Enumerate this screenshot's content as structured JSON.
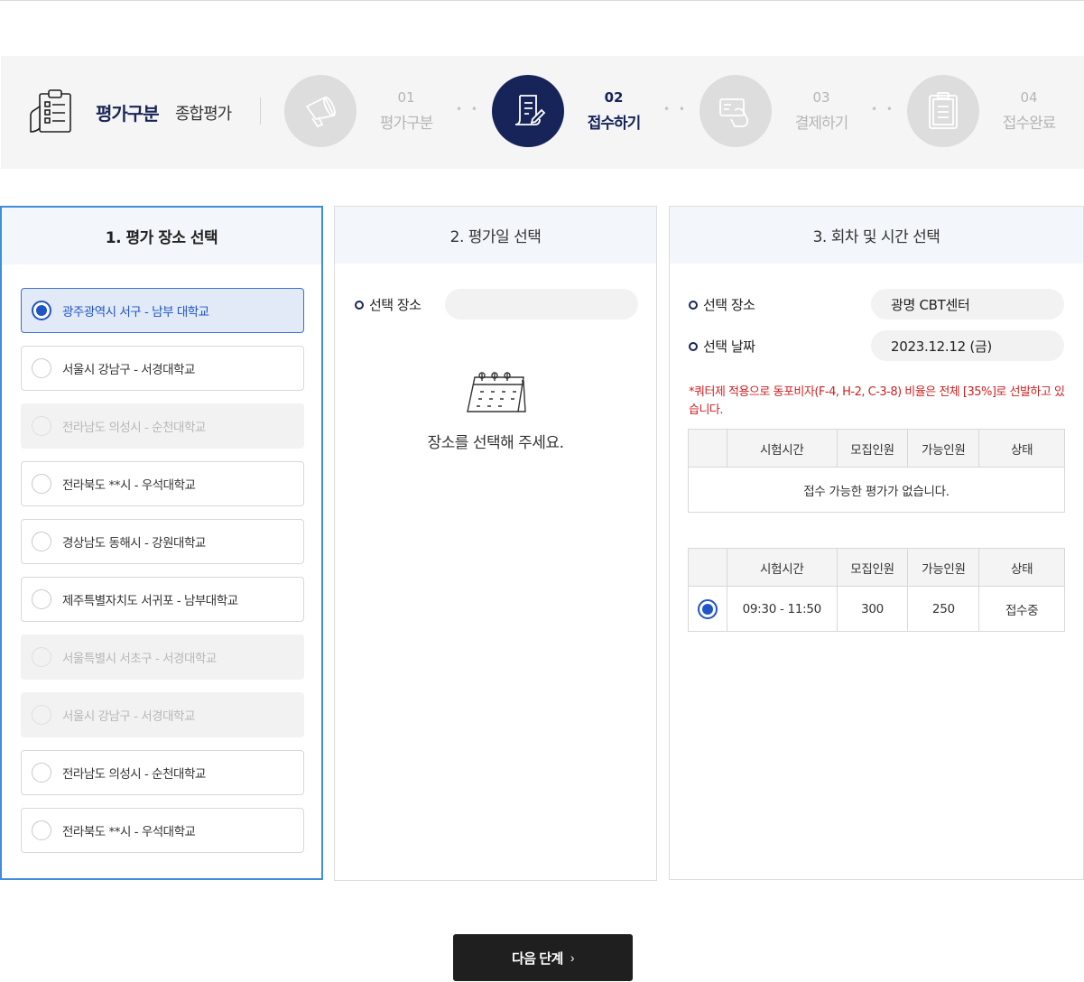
{
  "header": {
    "eval_label": "평가구분",
    "eval_value": "종합평가"
  },
  "steps": [
    {
      "num": "01",
      "name": "평가구분",
      "active": false,
      "icon": "megaphone-icon"
    },
    {
      "num": "02",
      "name": "접수하기",
      "active": true,
      "icon": "document-pen-icon"
    },
    {
      "num": "03",
      "name": "결제하기",
      "active": false,
      "icon": "card-payment-icon"
    },
    {
      "num": "04",
      "name": "접수완료",
      "active": false,
      "icon": "clipboard-icon"
    }
  ],
  "panel1": {
    "title": "1. 평가 장소 선택",
    "locations": [
      {
        "label": "광주광역시 서구 - 남부 대학교",
        "state": "selected"
      },
      {
        "label": "서울시 강남구 - 서경대학교",
        "state": "normal"
      },
      {
        "label": "전라남도 의성시 - 순천대학교",
        "state": "disabled"
      },
      {
        "label": "전라북도 **시 - 우석대학교",
        "state": "normal"
      },
      {
        "label": "경상남도 동해시 - 강원대학교",
        "state": "normal"
      },
      {
        "label": "제주특별자치도 서귀포 - 남부대학교",
        "state": "normal"
      },
      {
        "label": "서울특별시 서초구 - 서경대학교",
        "state": "disabled"
      },
      {
        "label": "서울시 강남구 - 서경대학교",
        "state": "disabled"
      },
      {
        "label": "전라남도 의성시 - 순천대학교",
        "state": "normal"
      },
      {
        "label": "전라북도 **시 - 우석대학교",
        "state": "normal"
      }
    ]
  },
  "panel2": {
    "title": "2. 평가일 선택",
    "place_label": "선택 장소",
    "place_value": "",
    "empty_message": "장소를 선택해 주세요."
  },
  "panel3": {
    "title": "3. 회차 및 시간 선택",
    "place_label": "선택 장소",
    "place_value": "광명 CBT센터",
    "date_label": "선택 날짜",
    "date_value": "2023.12.12 (금)",
    "notice": "*쿼터제 적용으로  동포비자(F-4, H-2, C-3-8) 비율은 전체 [35%]로 선발하고 있습니다.",
    "headers": [
      "",
      "시험시간",
      "모집인원",
      "가능인원",
      "상태"
    ],
    "table1_empty": "접수 가능한 평가가 없습니다.",
    "table2_rows": [
      {
        "time": "09:30 - 11:50",
        "recruit": "300",
        "available": "250",
        "status": "접수중",
        "selected": true
      }
    ]
  },
  "footer": {
    "next_label": "다음 단계",
    "next_chevron": "›"
  },
  "colors": {
    "navy": "#172459",
    "accent_blue": "#1f55c8",
    "panel_border_active": "#3f8ddb",
    "notice_red": "#d11f1f"
  }
}
